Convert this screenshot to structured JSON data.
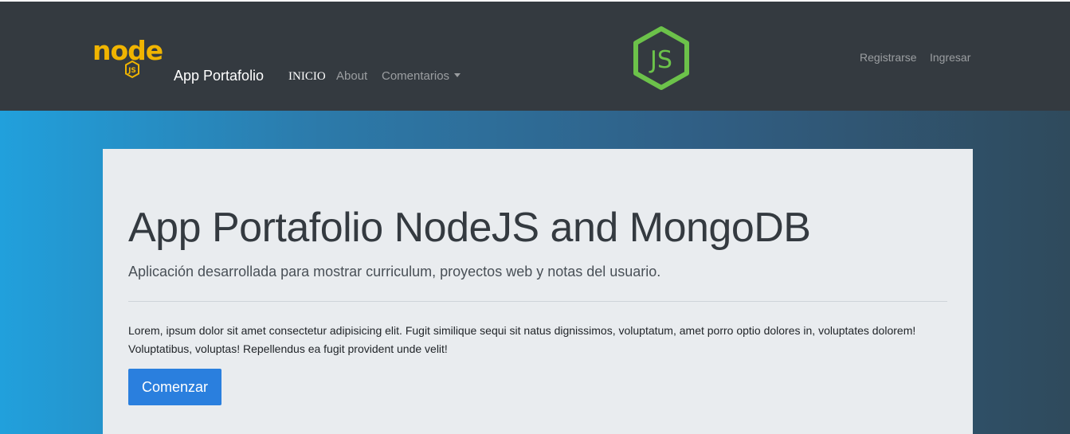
{
  "navbar": {
    "brand_logo_icon": "nodejs-logo-icon",
    "brand_logo_text": "node",
    "brand_logo_badge": "JS",
    "brand_text": "App Portafolio",
    "items": [
      {
        "label": "INICIO",
        "active": true
      },
      {
        "label": "About",
        "active": false
      },
      {
        "label": "Comentarios",
        "active": false,
        "dropdown": true
      }
    ],
    "center_logo_icon": "js-hexagon-logo-icon",
    "center_logo_text": "JS",
    "right_items": [
      {
        "label": "Registrarse"
      },
      {
        "label": "Ingresar"
      }
    ]
  },
  "jumbotron": {
    "title": "App Portafolio NodeJS and MongoDB",
    "lead": "Aplicación desarrollada para mostrar curriculum, proyectos web y notas del usuario.",
    "body": "Lorem, ipsum dolor sit amet consectetur adipisicing elit. Fugit similique sequi sit natus dignissimos, voluptatum, amet porro optio dolores in, voluptates dolorem! Voluptatibus, voluptas! Repellendus ea fugit provident unde velit!",
    "button_label": "Comenzar"
  },
  "colors": {
    "navbar_bg": "#343a40",
    "node_yellow": "#f0b400",
    "js_green": "#6cc24a",
    "primary_button": "#2a7fde",
    "jumbotron_bg": "#e9ecef",
    "hero_gradient_start": "#21a0dc",
    "hero_gradient_end": "#2f4a5c"
  }
}
